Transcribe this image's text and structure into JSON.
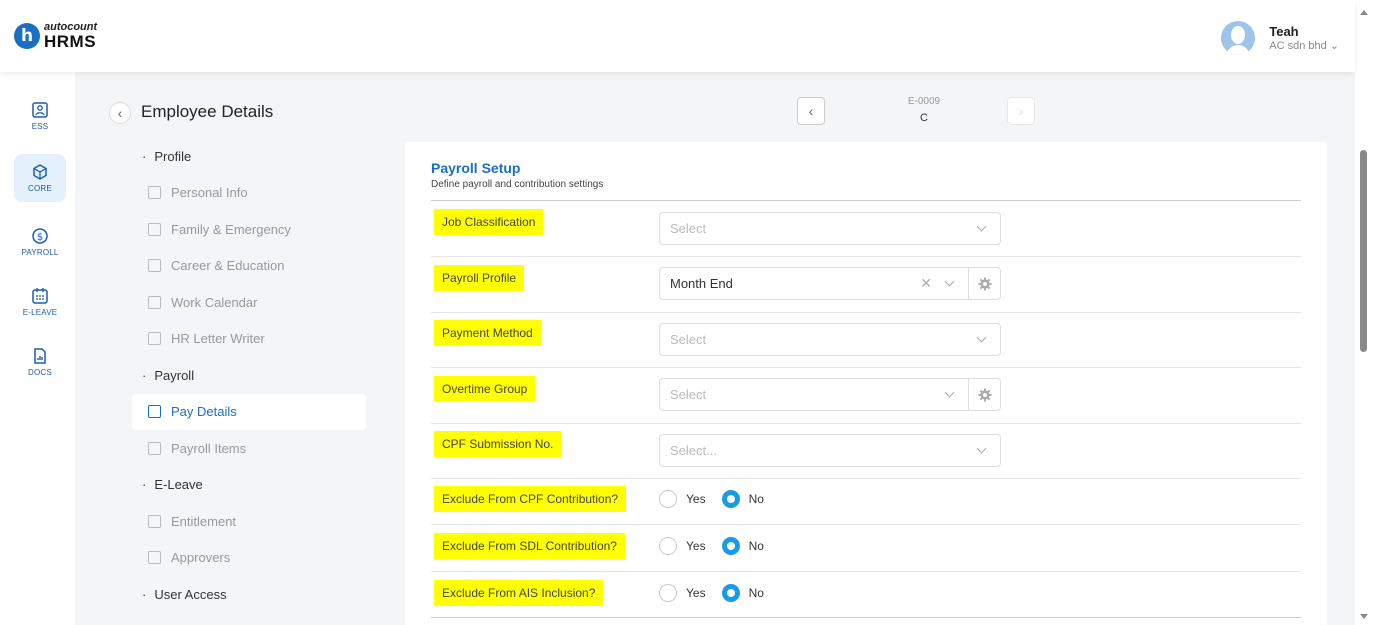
{
  "header": {
    "logo_mark": "h",
    "brand": "autocount",
    "product": "HRMS",
    "user_name": "Teah",
    "company": "AC sdn bhd"
  },
  "rail": [
    {
      "label": "ESS",
      "icon": "ess-icon"
    },
    {
      "label": "CORE",
      "icon": "core-icon",
      "active": true
    },
    {
      "label": "PAYROLL",
      "icon": "payroll-icon"
    },
    {
      "label": "E-LEAVE",
      "icon": "calendar-icon"
    },
    {
      "label": "DOCS",
      "icon": "docs-icon"
    }
  ],
  "page": {
    "title": "Employee Details",
    "record_id": "E-0009",
    "record_name": "C"
  },
  "nav": {
    "profile": "Profile",
    "personal_info": "Personal Info",
    "family": "Family & Emergency",
    "career": "Career & Education",
    "work_calendar": "Work Calendar",
    "hr_letter": "HR Letter Writer",
    "payroll": "Payroll",
    "pay_details": "Pay Details",
    "payroll_items": "Payroll Items",
    "eleave": "E-Leave",
    "entitlement": "Entitlement",
    "approvers": "Approvers",
    "user_access": "User Access"
  },
  "card": {
    "title": "Payroll Setup",
    "subtitle": "Define payroll and contribution settings"
  },
  "fields": {
    "job_classification": {
      "label": "Job Classification",
      "placeholder": "Select"
    },
    "payroll_profile": {
      "label": "Payroll Profile",
      "value": "Month End"
    },
    "payment_method": {
      "label": "Payment Method",
      "placeholder": "Select"
    },
    "overtime_group": {
      "label": "Overtime Group",
      "placeholder": "Select"
    },
    "cpf_submission": {
      "label": "CPF Submission No.",
      "placeholder": "Select..."
    },
    "exclude_cpf": {
      "label": "Exclude From CPF Contribution?",
      "selected": "No"
    },
    "exclude_sdl": {
      "label": "Exclude From SDL Contribution?",
      "selected": "No"
    },
    "exclude_ais": {
      "label": "Exclude From AIS Inclusion?",
      "selected": "No"
    }
  },
  "radio_options": {
    "yes": "Yes",
    "no": "No"
  },
  "colors": {
    "accent": "#1b6fc2",
    "highlight": "#ffff00",
    "radio_on": "#1b9be6"
  }
}
